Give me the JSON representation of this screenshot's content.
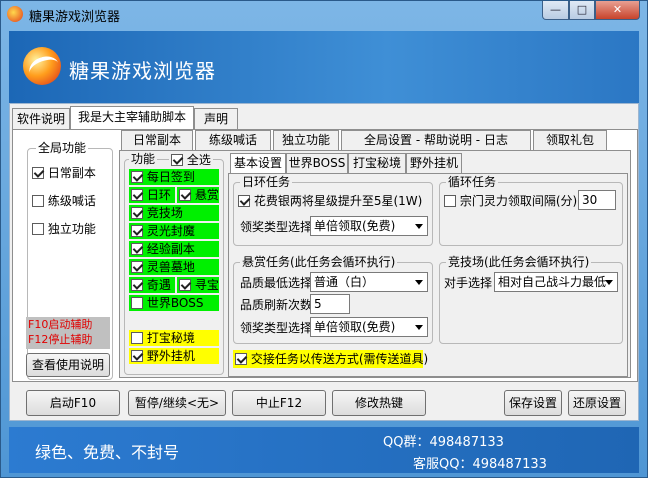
{
  "window": {
    "title": "糖果游戏浏览器",
    "min": "—",
    "max": "□",
    "close": "✕"
  },
  "banner": {
    "title": "糖果游戏浏览器"
  },
  "main_tabs": [
    "软件说明",
    "我是大主宰辅助脚本",
    "声明"
  ],
  "global": {
    "title": "全局功能",
    "items": [
      "日常副本",
      "练级喊话",
      "独立功能"
    ],
    "notes": [
      "F10启动辅助",
      "F12停止辅助"
    ],
    "help_button": "查看使用说明"
  },
  "sub_tabs": [
    "日常副本",
    "练级喊话",
    "独立功能",
    "全局设置 - 帮助说明 - 日志",
    "领取礼包"
  ],
  "functions": {
    "title": "功能",
    "select_all": "全选",
    "items": [
      "每日签到",
      "日环",
      "悬赏",
      "竞技场",
      "灵光封魔",
      "经验副本",
      "灵兽墓地",
      "奇遇",
      "寻宝",
      "世界BOSS"
    ],
    "extra": [
      "打宝秘境",
      "野外挂机"
    ]
  },
  "inner_tabs": [
    "基本设置",
    "世界BOSS",
    "打宝秘境",
    "野外挂机"
  ],
  "daily_ring": {
    "title": "日环任务",
    "checkbox": "花费银两将星级提升至5星(1W)",
    "reward_label": "领奖类型选择",
    "reward_value": "单倍领取(免费)"
  },
  "cycle": {
    "title": "循环任务",
    "checkbox": "宗门灵力领取间隔(分)",
    "value": "30"
  },
  "bounty": {
    "title": "悬赏任务(此任务会循环执行)",
    "quality_label": "品质最低选择",
    "quality_value": "普通（白）",
    "refresh_label": "品质刷新次数",
    "refresh_value": "5",
    "reward_label": "领奖类型选择",
    "reward_value": "单倍领取(免费)"
  },
  "arena": {
    "title": "竞技场(此任务会循环执行)",
    "opponent_label": "对手选择",
    "opponent_value": "相对自己战斗力最低"
  },
  "transport_checkbox": "交接任务以传送方式(需传送道具)",
  "buttons": [
    "启动F10",
    "暂停/继续<无>",
    "中止F12",
    "修改热键",
    "保存设置",
    "还原设置"
  ],
  "footer": {
    "slogan": "绿色、免费、不封号",
    "qq_group": "QQ群：498487133",
    "service_qq": "客服QQ：498487133"
  }
}
